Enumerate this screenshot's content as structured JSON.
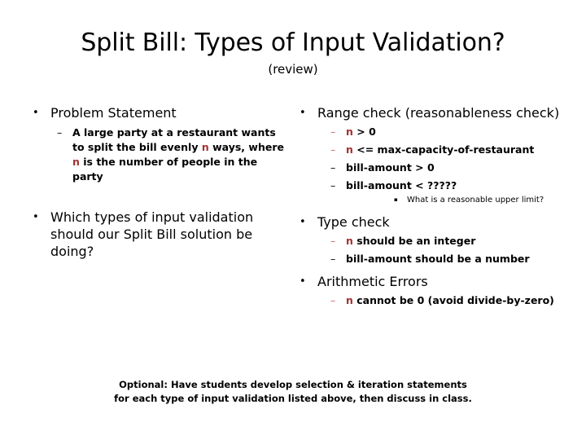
{
  "slide": {
    "title": "Split Bill: Types of Input Validation?",
    "subtitle": "(review)",
    "markers": {
      "disc": "•",
      "dash": "–",
      "square": "▪"
    },
    "colors": {
      "background": "#ffffff",
      "text": "#000000",
      "accent_red": "#a33131",
      "accent_red_dash": "#c46a6a"
    }
  },
  "left_column": {
    "items": [
      {
        "label": "Problem Statement",
        "sub": [
          {
            "parts": [
              {
                "text": "A large party at a restaurant wants to split the bill evenly ",
                "color": "black"
              },
              {
                "text": "n",
                "color": "red"
              },
              {
                "text": " ways, where ",
                "color": "black"
              },
              {
                "text": "n",
                "color": "red"
              },
              {
                "text": " is the number of people in the party",
                "color": "black"
              }
            ]
          }
        ]
      },
      {
        "label": "Which types of input validation should our Split Bill solution be doing?",
        "sub": []
      }
    ]
  },
  "right_column": {
    "items": [
      {
        "label": "Range check (reasonableness check)",
        "sub": [
          {
            "dash_red": true,
            "parts": [
              {
                "text": "n",
                "color": "red"
              },
              {
                "text": " > 0",
                "color": "black"
              }
            ]
          },
          {
            "dash_red": true,
            "parts": [
              {
                "text": "n",
                "color": "red"
              },
              {
                "text": " <= max-capacity-of-restaurant",
                "color": "black"
              }
            ]
          },
          {
            "dash_red": false,
            "parts": [
              {
                "text": "bill-amount > 0",
                "color": "black"
              }
            ]
          },
          {
            "dash_red": false,
            "parts": [
              {
                "text": "bill-amount < ?????",
                "color": "black"
              }
            ],
            "sub3": [
              {
                "text": "What is a reasonable upper limit?"
              }
            ]
          }
        ]
      },
      {
        "label": "Type check",
        "sub": [
          {
            "dash_red": true,
            "parts": [
              {
                "text": "n",
                "color": "red"
              },
              {
                "text": " should be an integer",
                "color": "black"
              }
            ]
          },
          {
            "dash_red": false,
            "parts": [
              {
                "text": "bill-amount should be a number",
                "color": "black"
              }
            ]
          }
        ]
      },
      {
        "label": "Arithmetic Errors",
        "sub": [
          {
            "dash_red": true,
            "parts": [
              {
                "text": "n",
                "color": "red"
              },
              {
                "text": " cannot be 0 (avoid divide-by-zero)",
                "color": "black"
              }
            ]
          }
        ]
      }
    ]
  },
  "footer": {
    "line1": "Optional: Have students develop selection & iteration statements",
    "line2": "for each type of input validation listed above, then discuss in class."
  }
}
